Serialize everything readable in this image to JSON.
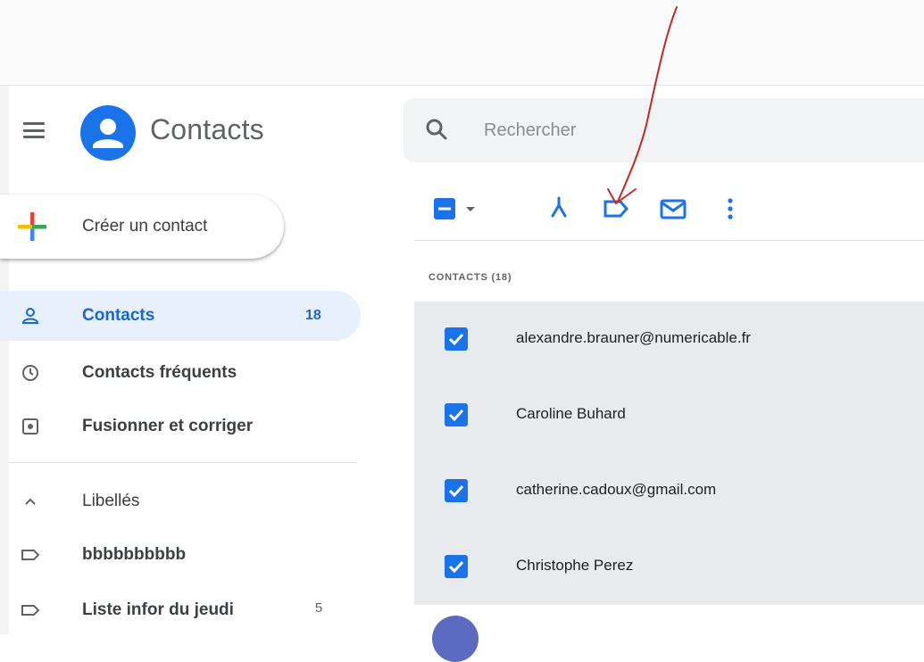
{
  "app": {
    "title": "Contacts",
    "menu_icon": "hamburger-menu-icon",
    "logo_icon": "contacts-person-logo",
    "brand_color": "#1a73e8"
  },
  "search": {
    "placeholder": "Rechercher",
    "value": "",
    "icon": "search-icon"
  },
  "create_button": {
    "label": "Créer un contact",
    "icon": "multicolor-plus-icon"
  },
  "sidebar": {
    "items": [
      {
        "label": "Contacts",
        "count": "18",
        "icon": "person-icon",
        "active": true
      },
      {
        "label": "Contacts fréquents",
        "count": "",
        "icon": "history-icon",
        "active": false
      },
      {
        "label": "Fusionner et corriger",
        "count": "",
        "icon": "merge-fix-icon",
        "active": false
      }
    ],
    "labels_section": {
      "label": "Libellés",
      "icon": "chevron-up-icon"
    },
    "labels": [
      {
        "label": "bbbbbbbbbb",
        "count": "",
        "icon": "label-outline-icon"
      },
      {
        "label": "Liste infor du jeudi",
        "count": "5",
        "icon": "label-outline-icon"
      }
    ]
  },
  "toolbar": {
    "select_state": "indeterminate",
    "icons": [
      "select-all-checkbox-icon",
      "select-dropdown-icon",
      "merge-icon",
      "manage-labels-icon",
      "email-icon",
      "more-vert-icon"
    ]
  },
  "contacts": {
    "header": "CONTACTS (18)",
    "rows": [
      {
        "name": "alexandre.brauner@numericable.fr",
        "checked": true
      },
      {
        "name": "Caroline Buhard",
        "checked": true
      },
      {
        "name": "catherine.cadoux@gmail.com",
        "checked": true
      },
      {
        "name": "Christophe Perez",
        "checked": true
      }
    ]
  },
  "annotation": {
    "type": "hand-drawn-arrow",
    "color": "#c62828"
  },
  "colors": {
    "active_bg": "#e8f0fe",
    "active_text": "#1967d2",
    "selected_row_bg": "#e8eaed",
    "checkbox": "#1a73e8"
  }
}
